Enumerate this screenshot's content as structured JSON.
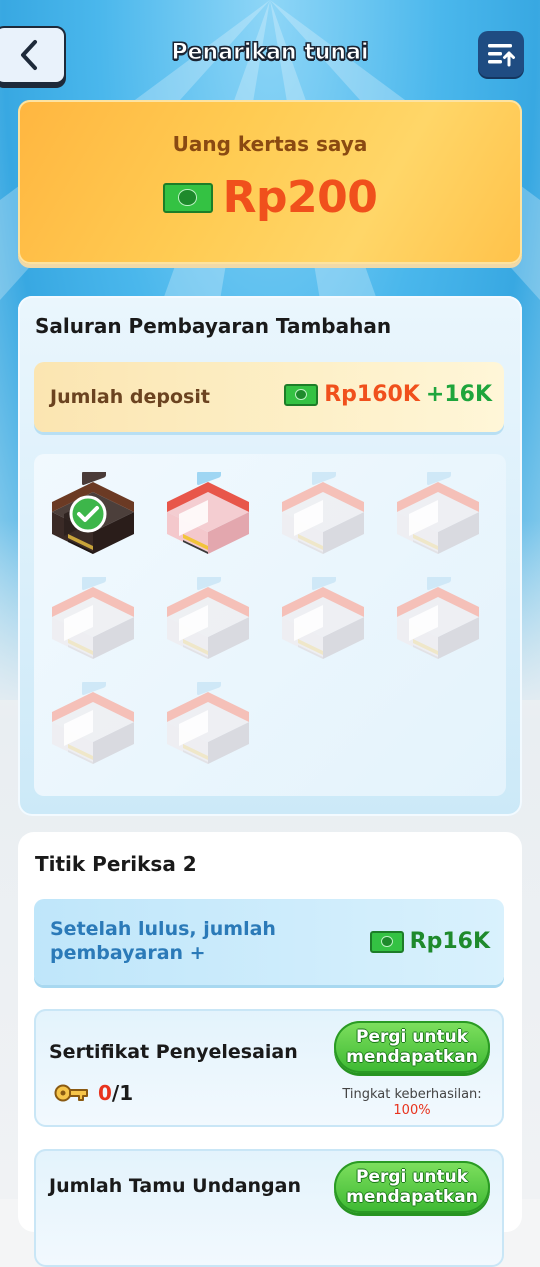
{
  "header": {
    "title": "Penarikan tunai"
  },
  "balance": {
    "label": "Uang kertas saya",
    "amount": "Rp200"
  },
  "extra_channels": {
    "title": "Saluran Pembayaran Tambahan",
    "deposit_label": "Jumlah deposit",
    "deposit_value": "Rp160K",
    "deposit_bonus": "+16K",
    "shops": [
      {
        "state": "completed"
      },
      {
        "state": "active"
      },
      {
        "state": "locked"
      },
      {
        "state": "locked"
      },
      {
        "state": "locked"
      },
      {
        "state": "locked"
      },
      {
        "state": "locked"
      },
      {
        "state": "locked"
      },
      {
        "state": "locked"
      },
      {
        "state": "locked"
      }
    ]
  },
  "checkpoint": {
    "title": "Titik Periksa 2",
    "after_label": "Setelah lulus, jumlah pembayaran +",
    "after_value": "Rp16K",
    "tasks": [
      {
        "name": "Sertifikat Penyelesaian",
        "progress_current": "0",
        "progress_total": "/1",
        "button": "Pergi untuk mendapatkan",
        "rate_label": "Tingkat keberhasilan:",
        "rate_value": "100%"
      },
      {
        "name": "Jumlah Tamu Undangan",
        "button": "Pergi untuk mendapatkan"
      }
    ]
  },
  "colors": {
    "accent_orange": "#f0501c",
    "accent_green": "#1ea53c",
    "sky_blue": "#4ab7ec"
  },
  "icons": {
    "back": "chevron-left-icon",
    "menu": "list-upload-icon",
    "cash": "cash-icon",
    "check": "check-icon",
    "key": "key-icon"
  }
}
